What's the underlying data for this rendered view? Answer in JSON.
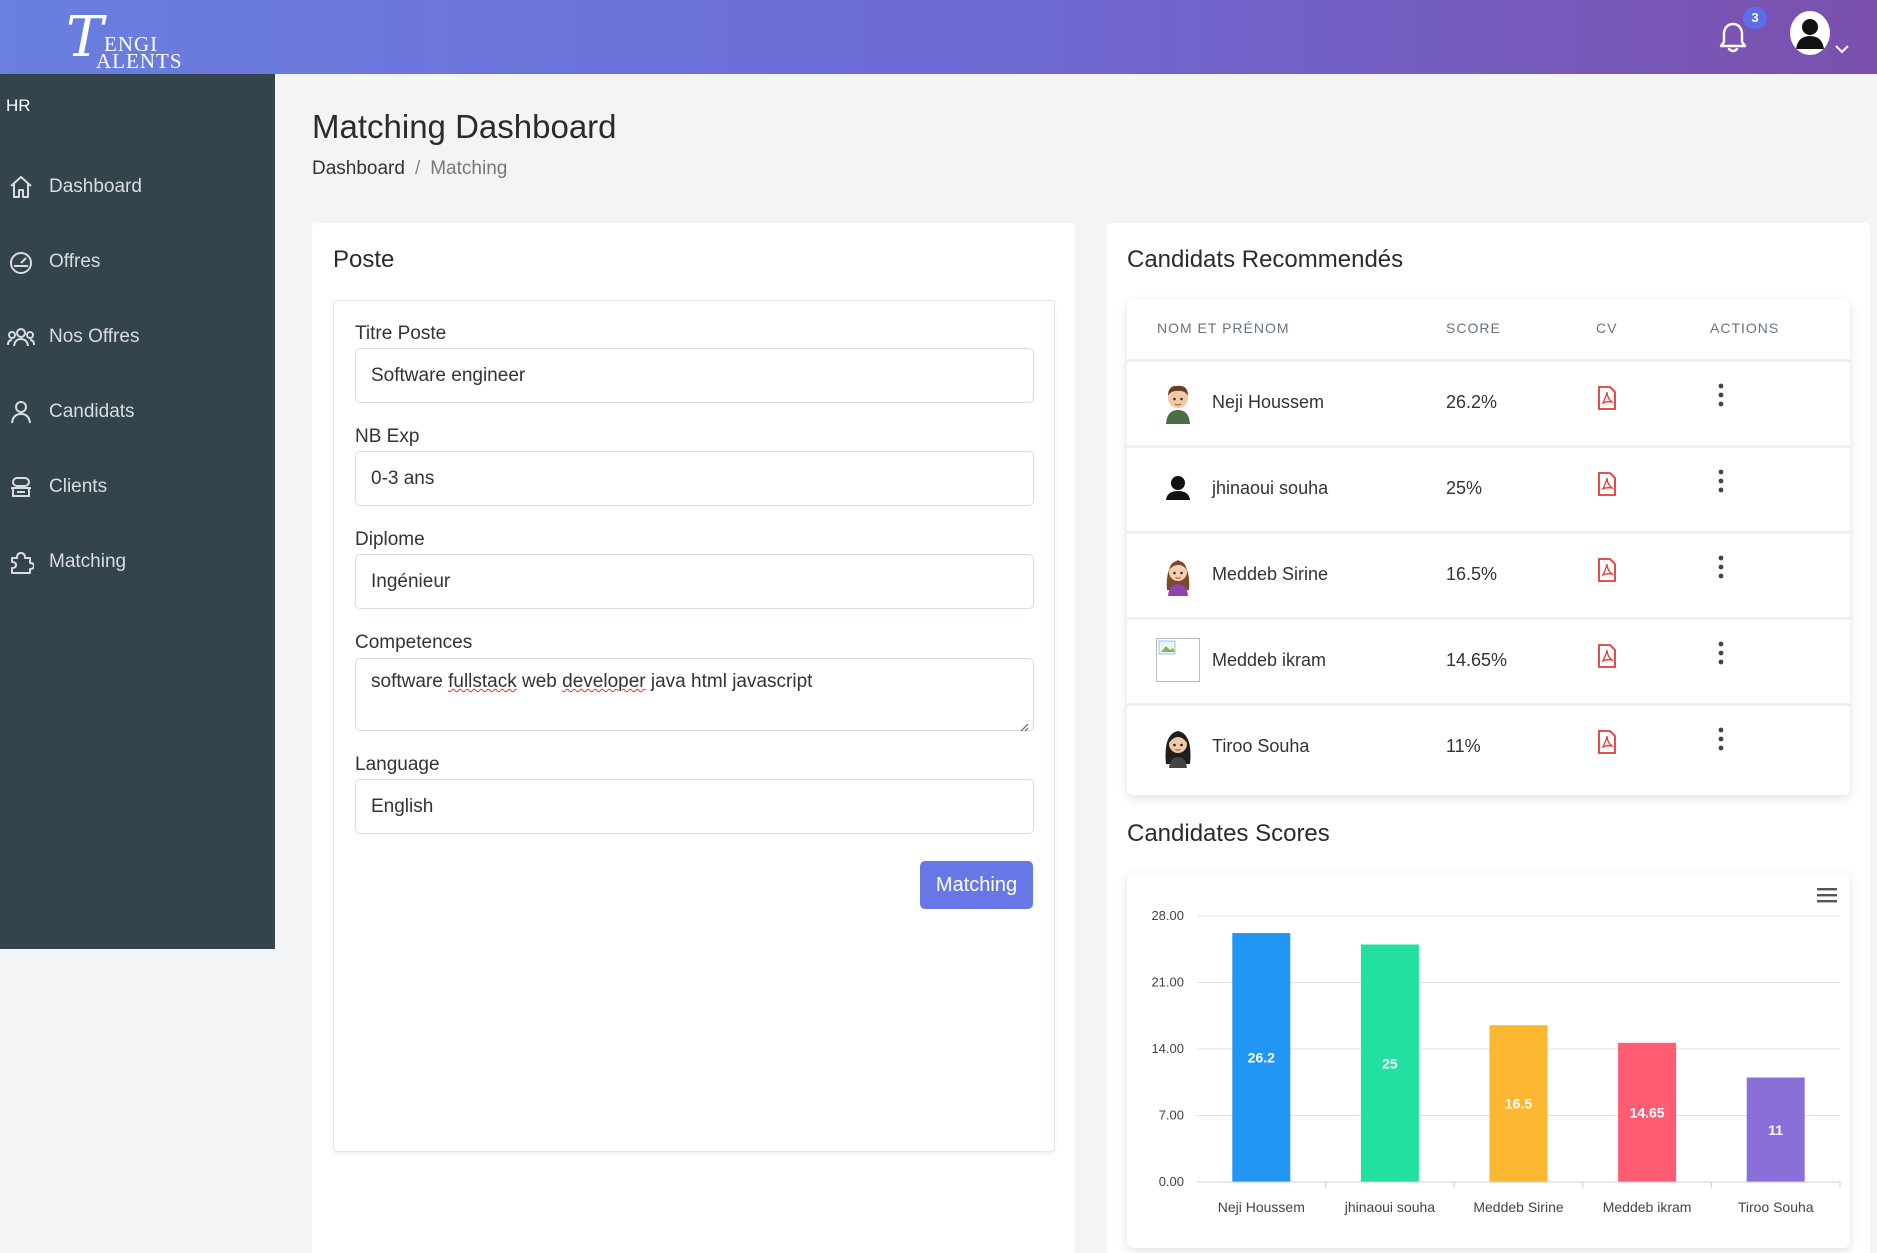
{
  "brand": {
    "logo_initial": "T",
    "logo_line1": "ENGI",
    "logo_line2": "ALENTS"
  },
  "header": {
    "notification_count": "3",
    "bell_icon": "bell-icon",
    "avatar_icon": "user-avatar-icon",
    "menu_icon": "chevron-down-icon"
  },
  "sidebar": {
    "role": "HR",
    "items": [
      {
        "label": "Dashboard",
        "icon": "home-icon"
      },
      {
        "label": "Offres",
        "icon": "speedometer-icon"
      },
      {
        "label": "Nos Offres",
        "icon": "users-group-icon"
      },
      {
        "label": "Candidats",
        "icon": "user-icon"
      },
      {
        "label": "Clients",
        "icon": "client-icon"
      },
      {
        "label": "Matching",
        "icon": "puzzle-icon"
      }
    ]
  },
  "page": {
    "title": "Matching Dashboard",
    "breadcrumb": {
      "root": "Dashboard",
      "separator": "/",
      "current": "Matching"
    }
  },
  "poste": {
    "title": "Poste",
    "fields": {
      "titre": {
        "label": "Titre Poste",
        "value": "Software engineer"
      },
      "exp": {
        "label": "NB Exp",
        "value": "0-3 ans"
      },
      "diplome": {
        "label": "Diplome",
        "value": "Ingénieur"
      },
      "competences": {
        "label": "Competences",
        "parts": [
          "software ",
          "fullstack",
          " web ",
          "developer",
          " java html javascript"
        ]
      },
      "language": {
        "label": "Language",
        "value": "English"
      }
    },
    "button": "Matching"
  },
  "candidats": {
    "title": "Candidats Recommendés",
    "columns": {
      "name": "NOM ET PRÉNOM",
      "score": "SCORE",
      "cv": "CV",
      "actions": "ACTIONS"
    },
    "rows": [
      {
        "name": "Neji Houssem",
        "score": "26.2%",
        "avatar": "male-avatar"
      },
      {
        "name": "jhinaoui souha",
        "score": "25%",
        "avatar": "default-person-avatar"
      },
      {
        "name": "Meddeb Sirine",
        "score": "16.5%",
        "avatar": "female-avatar"
      },
      {
        "name": "Meddeb ikram",
        "score": "14.65%",
        "avatar": "broken-image-avatar"
      },
      {
        "name": "Tiroo Souha",
        "score": "11%",
        "avatar": "female-dark-hair-avatar"
      }
    ]
  },
  "scores": {
    "title": "Candidates Scores",
    "menu_icon": "hamburger-menu-icon"
  },
  "chart_data": {
    "type": "bar",
    "categories": [
      "Neji Houssem",
      "jhinaoui souha",
      "Meddeb Sirine",
      "Meddeb ikram",
      "Tiroo Souha"
    ],
    "values": [
      26.2,
      25,
      16.5,
      14.65,
      11
    ],
    "data_labels": [
      "26.2",
      "25",
      "16.5",
      "14.65",
      "11"
    ],
    "colors": [
      "#2196f3",
      "#22e0a1",
      "#fbb632",
      "#ff5c74",
      "#8a6fd9"
    ],
    "yticks": [
      "0.00",
      "7.00",
      "14.00",
      "21.00",
      "28.00"
    ],
    "ylim": [
      0,
      28
    ],
    "grid": true
  },
  "colors": {
    "accent": "#6778e6",
    "sidebar": "#34444c",
    "pdf": "#e53935"
  }
}
